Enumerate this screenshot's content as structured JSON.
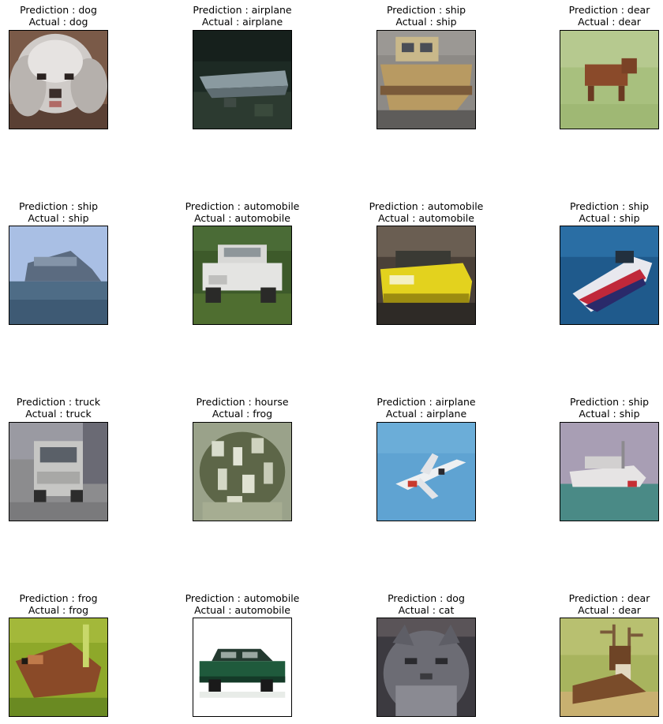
{
  "panels": [
    {
      "prediction": "Prediction : dog",
      "actual": "Actual : dog",
      "image": "white-poodle-dog-image"
    },
    {
      "prediction": "Prediction : airplane",
      "actual": "Actual : airplane",
      "image": "dark-airplane-image"
    },
    {
      "prediction": "Prediction : ship",
      "actual": "Actual : ship",
      "image": "tugboat-ship-image"
    },
    {
      "prediction": "Prediction : dear",
      "actual": "Actual : dear",
      "image": "deer-in-grass-image"
    },
    {
      "prediction": "Prediction : ship",
      "actual": "Actual : ship",
      "image": "cruise-ship-image"
    },
    {
      "prediction": "Prediction : automobile",
      "actual": "Actual : automobile",
      "image": "white-vintage-car-image"
    },
    {
      "prediction": "Prediction : automobile",
      "actual": "Actual : automobile",
      "image": "yellow-car-image"
    },
    {
      "prediction": "Prediction : ship",
      "actual": "Actual : ship",
      "image": "speedboat-ship-image"
    },
    {
      "prediction": "Prediction : truck",
      "actual": "Actual : truck",
      "image": "grey-truck-image"
    },
    {
      "prediction": "Prediction : hourse",
      "actual": "Actual : frog",
      "image": "frog-closeup-image"
    },
    {
      "prediction": "Prediction : airplane",
      "actual": "Actual : airplane",
      "image": "airplane-in-sky-image"
    },
    {
      "prediction": "Prediction : ship",
      "actual": "Actual : ship",
      "image": "white-ship-on-sea-image"
    },
    {
      "prediction": "Prediction : frog",
      "actual": "Actual : frog",
      "image": "brown-frog-image"
    },
    {
      "prediction": "Prediction : automobile",
      "actual": "Actual : automobile",
      "image": "green-car-image"
    },
    {
      "prediction": "Prediction : dog",
      "actual": "Actual : cat",
      "image": "grey-cat-image"
    },
    {
      "prediction": "Prediction : dear",
      "actual": "Actual : dear",
      "image": "deer-with-antlers-image"
    }
  ]
}
